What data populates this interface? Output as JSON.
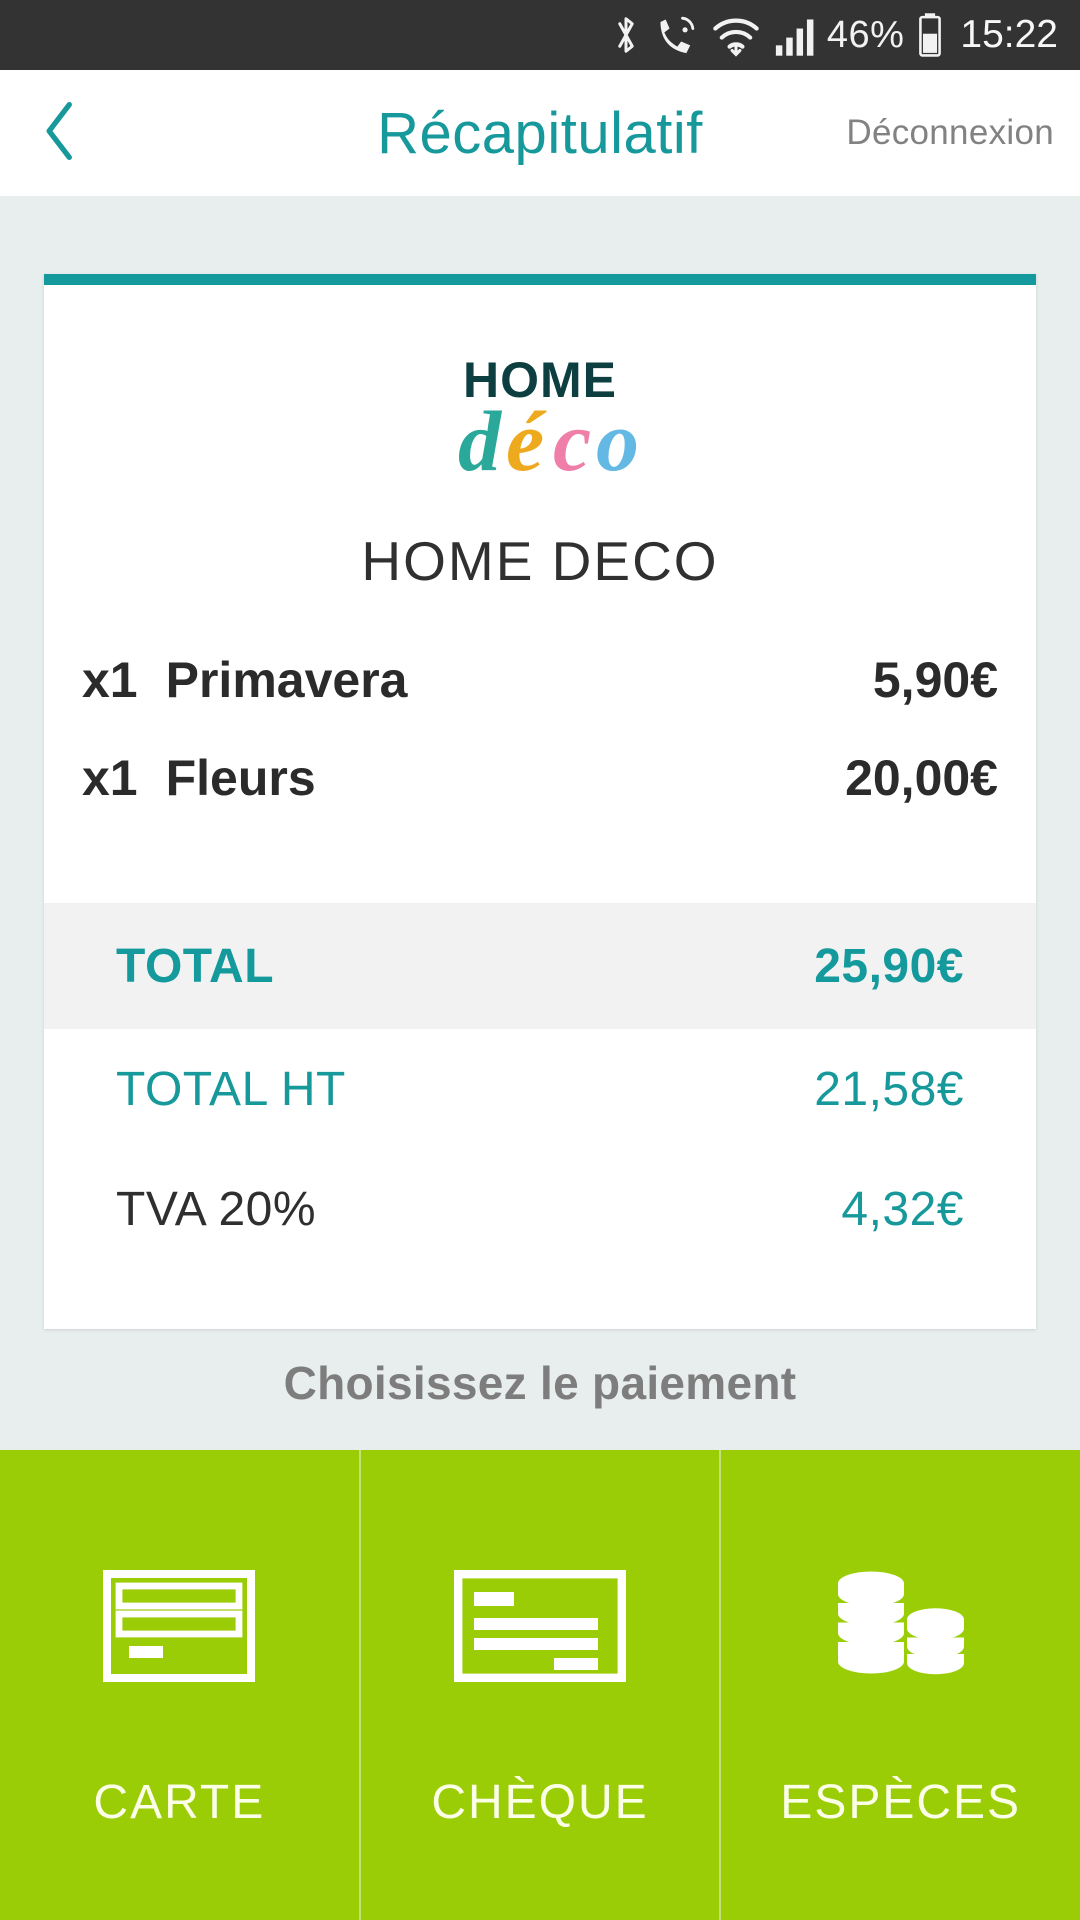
{
  "statusbar": {
    "icons": [
      "bluetooth-icon",
      "wifi-calling-icon",
      "wifi-icon",
      "signal-bars-icon",
      "battery-icon"
    ],
    "battery_percent": "46%",
    "clock": "15:22"
  },
  "header": {
    "back_icon": "chevron-left-icon",
    "title": "Récapitulatif",
    "logout_label": "Déconnexion"
  },
  "ticket": {
    "logo": {
      "top_text": "HOME",
      "script_text": "déco",
      "colors": {
        "home": "#0d3f40",
        "d": "#2aa89a",
        "e_accent": "#edaa1e",
        "c": "#ef7fa8",
        "o": "#63b8e4"
      }
    },
    "shop_name": "HOME DECO",
    "items": [
      {
        "qty": "x1",
        "name": "Primavera",
        "price": "5,90€"
      },
      {
        "qty": "x1",
        "name": "Fleurs",
        "price": "20,00€"
      }
    ],
    "total": {
      "label": "TOTAL",
      "value": "25,90€"
    },
    "subtotals": [
      {
        "label": "TOTAL HT",
        "value": "21,58€"
      },
      {
        "label": "TVA 20%",
        "value": "4,32€"
      }
    ],
    "accent_color": "#14999c"
  },
  "choose_payment_label": "Choisissez le paiement",
  "payment": {
    "background_color": "#9bcd06",
    "options": [
      {
        "label": "CARTE",
        "icon": "credit-card-icon"
      },
      {
        "label": "CHÈQUE",
        "icon": "cheque-icon"
      },
      {
        "label": "ESPÈCES",
        "icon": "coins-icon"
      }
    ]
  }
}
